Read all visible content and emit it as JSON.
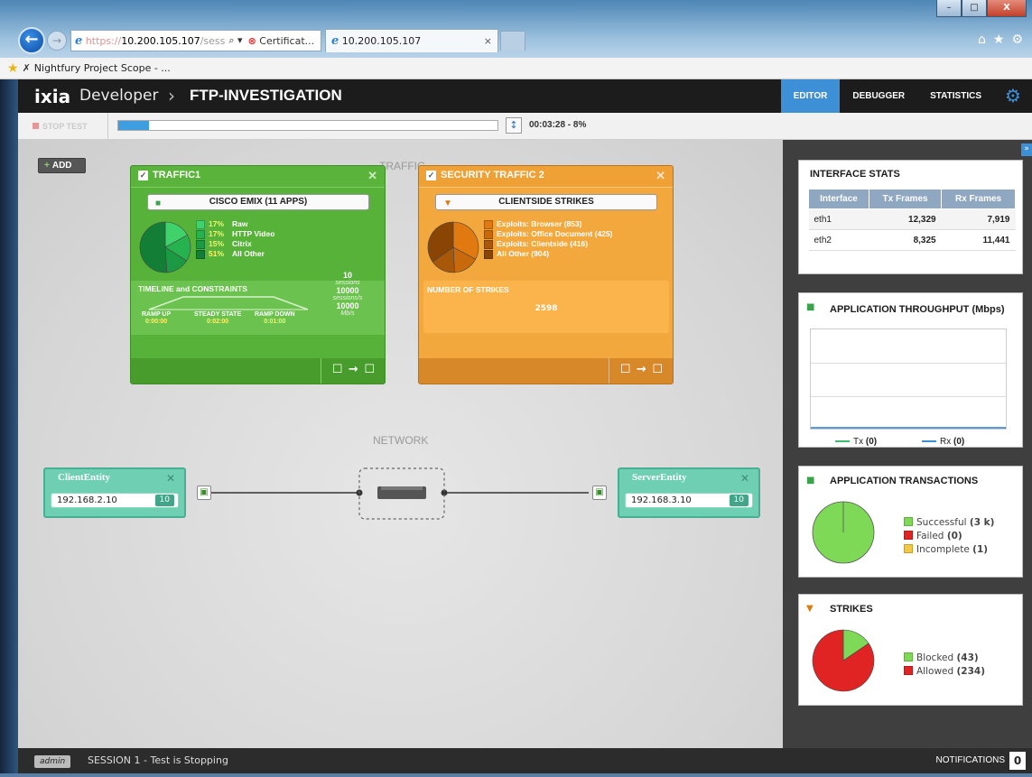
{
  "browser": {
    "address_https": "https://",
    "address_host": "10.200.105.107",
    "address_rest": "/sess",
    "address_search_glyph": "⌕ ▾",
    "cert_label": "Certificat...",
    "cert_glyph": "⊗",
    "refresh_glyph": "↻",
    "tab_title": "10.200.105.107",
    "tab_close": "×",
    "favorite": "Nightfury Project Scope - ...",
    "minimize": "–",
    "maximize": "□",
    "close": "X",
    "back_glyph": "←",
    "forward_glyph": "→",
    "home_glyph": "⌂",
    "star_glyph": "★",
    "tools_glyph": "⚙"
  },
  "app": {
    "logo": "IXIA",
    "product": "Developer",
    "separator": "›",
    "project": "FTP-INVESTIGATION",
    "nav": [
      "EDITOR",
      "DEBUGGER",
      "STATISTICS"
    ],
    "active_nav": "EDITOR",
    "gear_glyph": "⚙"
  },
  "control": {
    "stop_label": "STOP TEST",
    "progress_percent": 8,
    "pin_glyph": "↕",
    "timer": "00:03:28 - 8%"
  },
  "canvas": {
    "add_label": "ADD",
    "add_glyph": "+",
    "traffic_label": "TRAFFIC",
    "network_label": "NETWORK"
  },
  "traffic1": {
    "title": "TRAFFIC1",
    "check": "✓",
    "close": "✕",
    "app_name": "CISCO EMIX (11 APPS)",
    "app_glyph": "■",
    "mix": [
      {
        "pct": "17%",
        "name": "Raw",
        "color": "#3fd26a"
      },
      {
        "pct": "17%",
        "name": "HTTP Video",
        "color": "#26b24f"
      },
      {
        "pct": "15%",
        "name": "Citrix",
        "color": "#1c9a43"
      },
      {
        "pct": "51%",
        "name": "All Other",
        "color": "#127e36"
      }
    ],
    "timeline_title": "TIMELINE and CONSTRAINTS",
    "ramp_up_label": "RAMP UP",
    "ramp_up": "0:00:00",
    "steady_label": "STEADY STATE",
    "steady": "0:02:00",
    "ramp_down_label": "RAMP DOWN",
    "ramp_down": "0:01:00",
    "sessions": "10",
    "sessions_unit": "sessions",
    "rate": "10000",
    "rate_unit": "sessions/s",
    "bw": "10000",
    "bw_unit": "Mb/s",
    "foot_glyph": "☐ → ☐"
  },
  "traffic2": {
    "title": "SECURITY TRAFFIC 2",
    "check": "✓",
    "close": "✕",
    "app_name": "CLIENTSIDE STRIKES",
    "app_glyph": "▼",
    "mix": [
      {
        "name": "Exploits: Browser (853)",
        "color": "#e07a10"
      },
      {
        "name": "Exploits: Office Document (425)",
        "color": "#c86a0c"
      },
      {
        "name": "Exploits: Clientside (416)",
        "color": "#a95708"
      },
      {
        "name": "All Other (904)",
        "color": "#8a4505"
      }
    ],
    "strikes_title": "NUMBER OF STRIKES",
    "strikes_count": "2598",
    "foot_glyph": "☐ → ☐"
  },
  "network": {
    "client": {
      "name": "ClientEntity",
      "ip": "192.168.2.10",
      "count": "10",
      "close": "✕"
    },
    "server": {
      "name": "ServerEntity",
      "ip": "192.168.3.10",
      "count": "10",
      "close": "✕"
    },
    "port_glyph": "▣"
  },
  "right": {
    "collapse_glyph": "»",
    "interface_stats": {
      "title": "INTERFACE STATS",
      "columns": [
        "Interface",
        "Tx Frames",
        "Rx Frames"
      ],
      "rows": [
        [
          "eth1",
          "12,329",
          "7,919"
        ],
        [
          "eth2",
          "8,325",
          "11,441"
        ]
      ]
    },
    "throughput": {
      "title": "APPLICATION THROUGHPUT (Mbps)",
      "tx_label": "Tx",
      "tx_value": "(0)",
      "rx_label": "Rx",
      "rx_value": "(0)",
      "tx_color": "#3cbf6b",
      "rx_color": "#3d8fd6"
    },
    "transactions": {
      "title": "APPLICATION TRANSACTIONS",
      "items": [
        {
          "label": "Successful",
          "value": "(3 k)",
          "color": "#7ed957"
        },
        {
          "label": "Failed",
          "value": "(0)",
          "color": "#e02424"
        },
        {
          "label": "Incomplete",
          "value": "(1)",
          "color": "#f5c842"
        }
      ]
    },
    "strikes": {
      "title": "STRIKES",
      "items": [
        {
          "label": "Blocked",
          "value": "(43)",
          "count": 43,
          "color": "#7ed957"
        },
        {
          "label": "Allowed",
          "value": "(234)",
          "count": 234,
          "color": "#e02424"
        }
      ]
    }
  },
  "status": {
    "user": "admin",
    "session": "SESSION 1 - Test is Stopping",
    "notifications_label": "NOTIFICATIONS",
    "notifications_count": "0"
  }
}
